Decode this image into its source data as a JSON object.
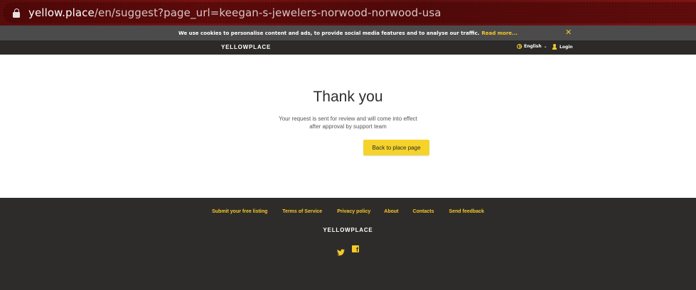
{
  "browser": {
    "url_host": "yellow.place",
    "url_path": "/en/suggest?page_url=keegan-s-jewelers-norwood-norwood-usa"
  },
  "cookie_banner": {
    "text": "We use cookies to personalise content and ads, to provide social media features and to analyse our traffic.",
    "link_label": "Read more...",
    "close_icon": "✕"
  },
  "header": {
    "logo": "YELLOWPLACE",
    "language": "English",
    "login_label": "Login",
    "icons": {
      "language": "globe-icon",
      "login": "user-icon"
    }
  },
  "main": {
    "title": "Thank you",
    "message_line1": "Your request is sent for review and will come into effect",
    "message_line2": "after approval by support team",
    "button_label": "Back to place page"
  },
  "footer": {
    "links": [
      {
        "label": "Submit your free listing"
      },
      {
        "label": "Terms of Service"
      },
      {
        "label": "Privacy policy"
      },
      {
        "label": "About"
      },
      {
        "label": "Contacts"
      },
      {
        "label": "Send feedback"
      }
    ],
    "logo": "YELLOWPLACE",
    "social_icons": [
      "twitter-icon",
      "facebook-icon"
    ]
  },
  "colors": {
    "brand_yellow": "#f5d32b",
    "link_yellow": "#f5c928",
    "dark": "#2e2c2a",
    "cookie_bg": "#4b4b4b"
  }
}
